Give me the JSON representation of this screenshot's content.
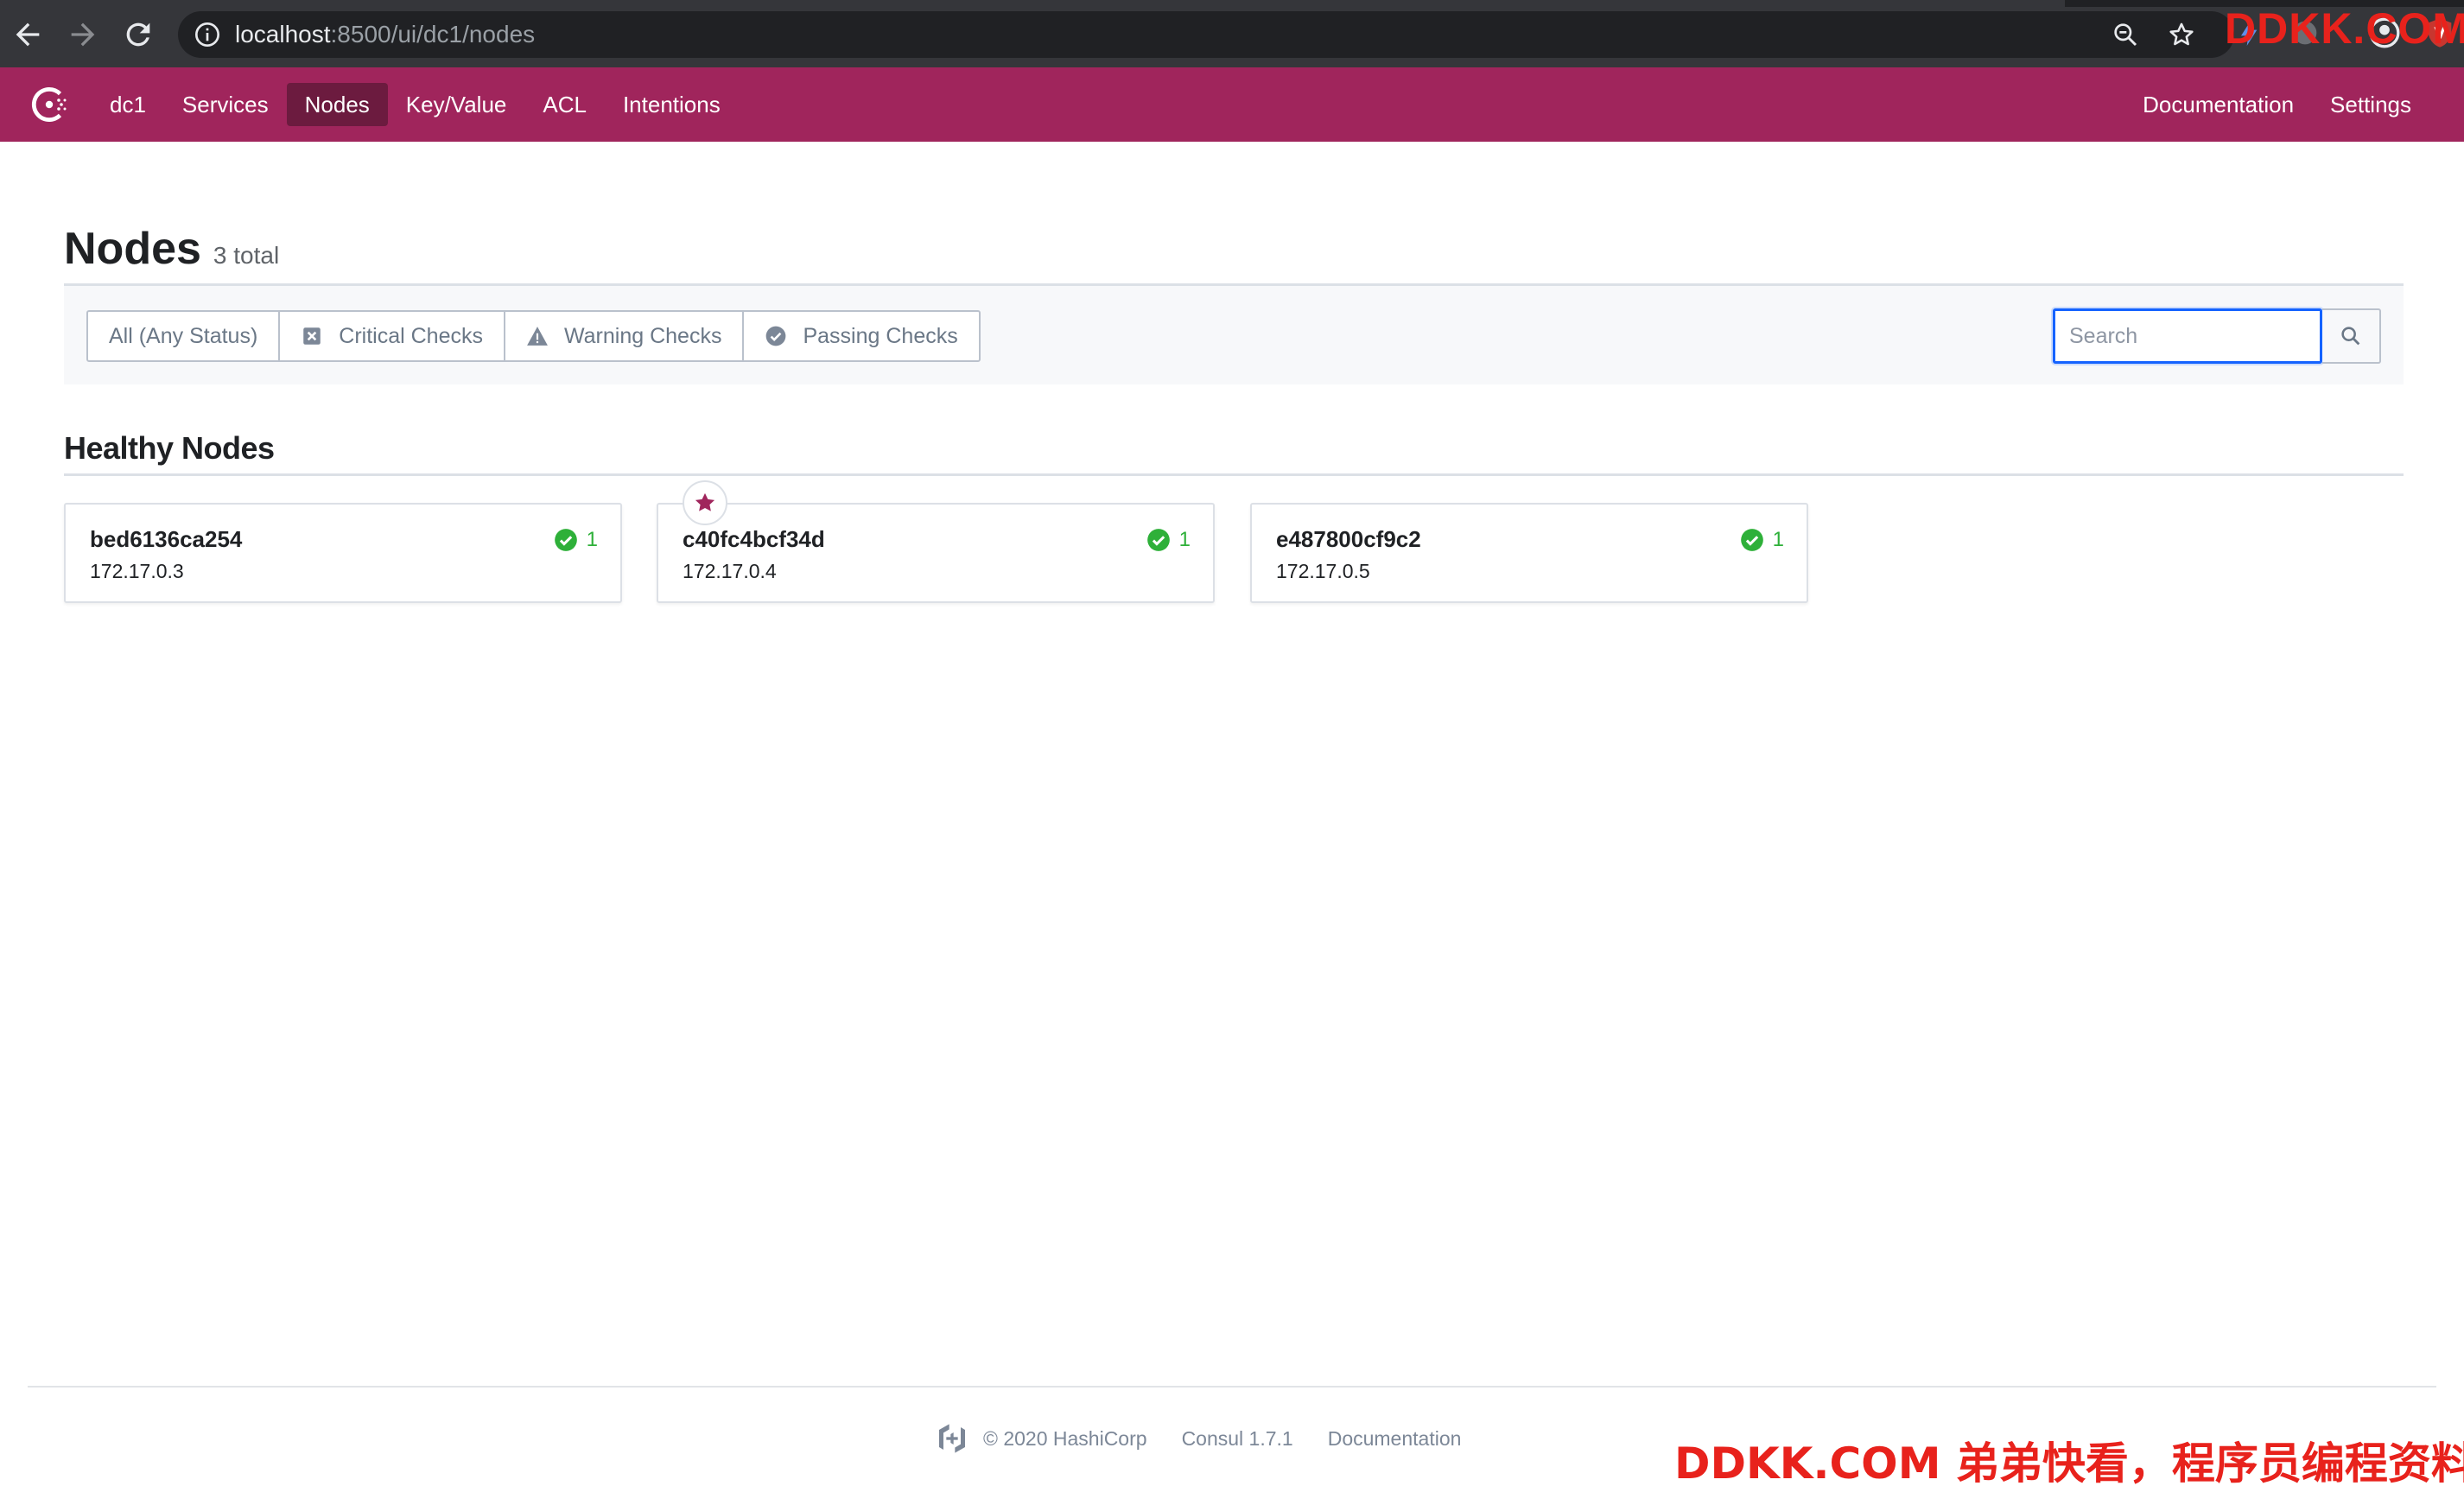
{
  "browser": {
    "url_host": "localhost",
    "url_path": ":8500/ui/dc1/nodes",
    "watermark": "DDKK.COM"
  },
  "header": {
    "datacenter": "dc1",
    "nav": [
      "Services",
      "Nodes",
      "Key/Value",
      "ACL",
      "Intentions"
    ],
    "active_nav": "Nodes",
    "right_nav": [
      "Documentation",
      "Settings"
    ],
    "brand_color": "#a0255c"
  },
  "page": {
    "title": "Nodes",
    "count": "3 total"
  },
  "filters": {
    "options": [
      "All (Any Status)",
      "Critical Checks",
      "Warning Checks",
      "Passing Checks"
    ],
    "selected": "All (Any Status)",
    "search_placeholder": "Search"
  },
  "section": {
    "title": "Healthy Nodes"
  },
  "nodes": [
    {
      "name": "bed6136ca254",
      "address": "172.17.0.3",
      "passing": "1",
      "leader": false
    },
    {
      "name": "c40fc4bcf34d",
      "address": "172.17.0.4",
      "passing": "1",
      "leader": true
    },
    {
      "name": "e487800cf9c2",
      "address": "172.17.0.5",
      "passing": "1",
      "leader": false
    }
  ],
  "footer": {
    "copyright": "© 2020 HashiCorp",
    "version": "Consul 1.7.1",
    "docs": "Documentation"
  },
  "watermark_bottom": "DDKK.COM 弟弟快看，程序员编程资料站"
}
